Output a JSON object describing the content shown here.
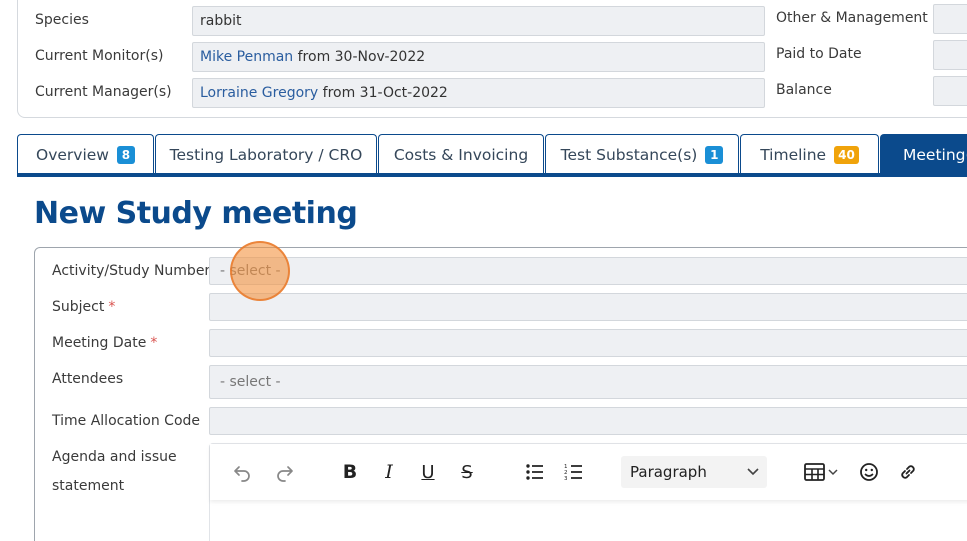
{
  "info": {
    "species_label": "Species",
    "species_value": "rabbit",
    "monitor_label": "Current Monitor(s)",
    "monitor_name": "Mike Penman",
    "monitor_suffix": " from 30-Nov-2022",
    "manager_label": "Current Manager(s)",
    "manager_name": "Lorraine Gregory",
    "manager_suffix": " from 31-Oct-2022",
    "other_label": "Other & Management",
    "paid_label": "Paid to Date",
    "balance_label": "Balance"
  },
  "tabs": [
    {
      "label": "Overview",
      "badge": "8"
    },
    {
      "label": "Testing Laboratory / CRO"
    },
    {
      "label": "Costs & Invoicing"
    },
    {
      "label": "Test Substance(s)",
      "badge": "1"
    },
    {
      "label": "Timeline",
      "badge": "40"
    },
    {
      "label": "Meeting(s"
    }
  ],
  "heading": "New Study meeting",
  "form": {
    "activity_label": "Activity/Study Number",
    "activity_placeholder": "- select -",
    "subject_label": "Subject",
    "date_label": "Meeting Date",
    "attendees_label": "Attendees",
    "attendees_placeholder": "- select -",
    "time_code_label": "Time Allocation Code",
    "agenda_label_line1": "Agenda and issue",
    "agenda_label_line2": "statement",
    "required_mark": "*"
  },
  "editor": {
    "paragraph_label": "Paragraph"
  },
  "colors": {
    "brand": "#0b4a8c",
    "badge_blue": "#1a8fd6",
    "badge_orange": "#f0a30a",
    "required": "#d9534f"
  }
}
